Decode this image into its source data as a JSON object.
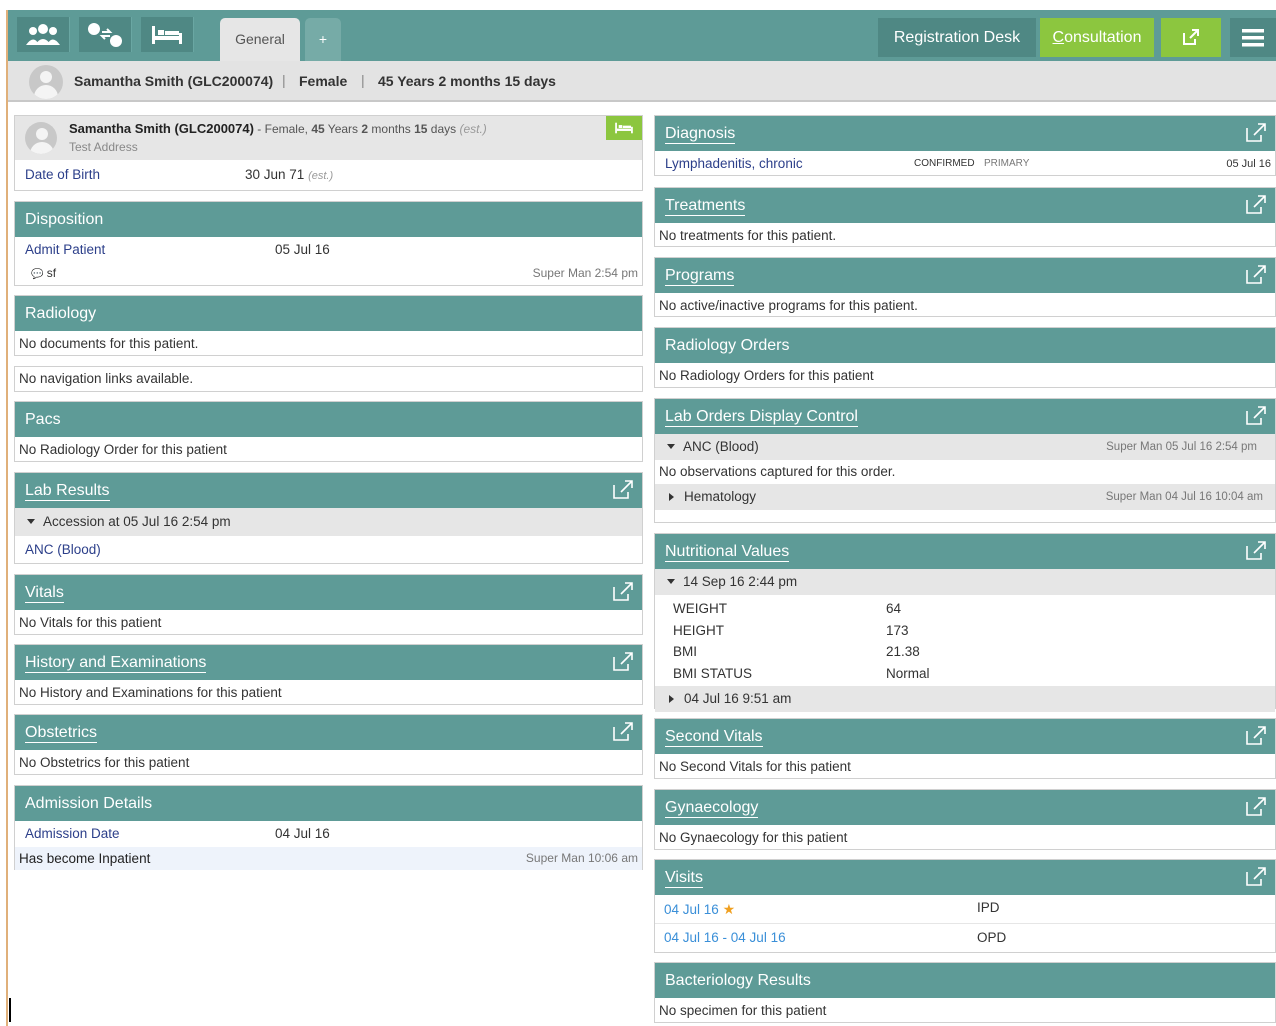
{
  "nav": {
    "tab_general": "General",
    "tab_add": "+",
    "registration_desk": "Registration Desk",
    "consultation_first": "C",
    "consultation_rest": "onsultation"
  },
  "strip": {
    "name": "Samantha Smith (GLC200074)",
    "gender": "Female",
    "age": "45 Years 2 months 15 days"
  },
  "patient_card": {
    "name": "Samantha Smith (GLC200074)",
    "sep1": " - Female, ",
    "years": "45",
    "years_label": " Years ",
    "months": "2",
    "months_label": " months ",
    "days": "15",
    "days_label": " days ",
    "est": "(est.)",
    "address": "Test Address",
    "dob_label": "Date of Birth",
    "dob_value": "30 Jun 71",
    "dob_est": "(est.)"
  },
  "disposition": {
    "title": "Disposition",
    "action": "Admit Patient",
    "date": "05 Jul 16",
    "note": "sf",
    "meta": "Super Man 2:54 pm"
  },
  "radiology": {
    "title": "Radiology",
    "empty": "No documents for this patient."
  },
  "navlinks": {
    "empty": "No navigation links available."
  },
  "pacs": {
    "title": "Pacs",
    "empty": "No Radiology Order for this patient"
  },
  "lab_results": {
    "title": "Lab Results",
    "accession": "Accession at 05 Jul 16 2:54 pm",
    "test": "ANC (Blood)"
  },
  "vitals": {
    "title": "Vitals",
    "empty": "No Vitals for this patient"
  },
  "history": {
    "title": "History and Examinations",
    "empty": "No History and Examinations for this patient"
  },
  "obstetrics": {
    "title": "Obstetrics",
    "empty": "No Obstetrics for this patient"
  },
  "admission": {
    "title": "Admission Details",
    "date_label": "Admission Date",
    "date_value": "04 Jul 16",
    "status": "Has become Inpatient",
    "meta": "Super Man 10:06 am"
  },
  "diagnosis": {
    "title": "Diagnosis",
    "name": "Lymphadenitis, chronic",
    "certainty": "CONFIRMED",
    "order": "PRIMARY",
    "date": "05 Jul 16"
  },
  "treatments": {
    "title": "Treatments",
    "empty": "No treatments for this patient."
  },
  "programs": {
    "title": "Programs",
    "empty": "No active/inactive programs for this patient."
  },
  "radiology_orders": {
    "title": "Radiology Orders",
    "empty": "No Radiology Orders for this patient"
  },
  "lab_orders": {
    "title": "Lab Orders Display Control",
    "order1": "ANC (Blood)",
    "order1_meta": "Super Man  05 Jul 16 2:54 pm",
    "order1_empty": "No observations captured for this order.",
    "order2": "Hematology",
    "order2_meta": "Super Man  04 Jul 16 10:04 am"
  },
  "nutrition": {
    "title": "Nutritional Values",
    "date1": "14 Sep 16 2:44 pm",
    "rows": [
      {
        "label": "WEIGHT",
        "value": "64"
      },
      {
        "label": "HEIGHT",
        "value": "173"
      },
      {
        "label": "BMI",
        "value": "21.38"
      },
      {
        "label": "BMI STATUS",
        "value": "Normal"
      }
    ],
    "date2": "04 Jul 16 9:51 am"
  },
  "second_vitals": {
    "title": "Second Vitals",
    "empty": "No Second Vitals for this patient"
  },
  "gynaecology": {
    "title": "Gynaecology",
    "empty": "No Gynaecology for this patient"
  },
  "visits": {
    "title": "Visits",
    "items": [
      {
        "date": "04 Jul 16",
        "type": "IPD"
      },
      {
        "date": "04 Jul 16 - 04 Jul 16",
        "type": "OPD"
      }
    ]
  },
  "bacteriology": {
    "title": "Bacteriology Results",
    "empty": "No specimen for this patient"
  },
  "colors": {
    "header": "#5e9b97",
    "accent_green": "#8cc63f",
    "link": "#3a8fd8"
  }
}
